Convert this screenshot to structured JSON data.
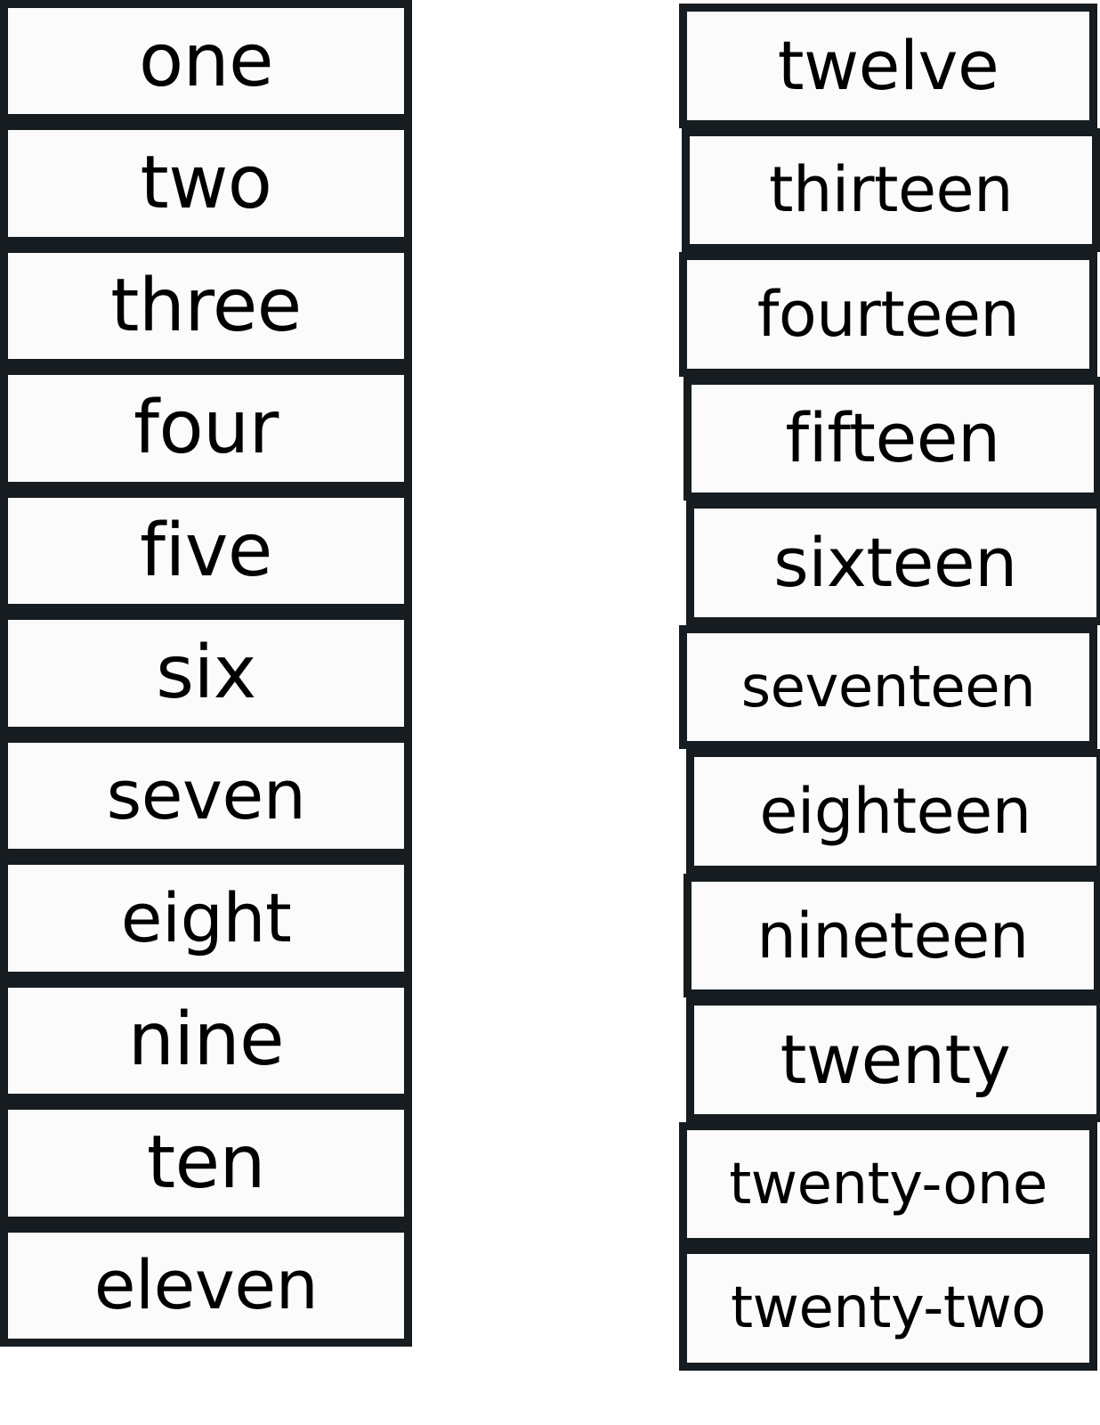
{
  "page": {
    "background_color": "#ffffff",
    "card_border_color": "#161c1f",
    "card_face_color": "#fbfbfb",
    "text_color": "#000000"
  },
  "columns": [
    {
      "id": "left",
      "name": "number-words-column-one-to-eleven",
      "cards": [
        {
          "word": "one"
        },
        {
          "word": "two"
        },
        {
          "word": "three"
        },
        {
          "word": "four"
        },
        {
          "word": "five"
        },
        {
          "word": "six"
        },
        {
          "word": "seven"
        },
        {
          "word": "eight"
        },
        {
          "word": "nine"
        },
        {
          "word": "ten"
        },
        {
          "word": "eleven"
        }
      ]
    },
    {
      "id": "right",
      "name": "number-words-column-twelve-to-twenty-two",
      "cards": [
        {
          "word": "twelve"
        },
        {
          "word": "thirteen"
        },
        {
          "word": "fourteen"
        },
        {
          "word": "fifteen"
        },
        {
          "word": "sixteen"
        },
        {
          "word": "seventeen"
        },
        {
          "word": "eighteen"
        },
        {
          "word": "nineteen"
        },
        {
          "word": "twenty"
        },
        {
          "word": "twenty-one"
        },
        {
          "word": "twenty-two"
        }
      ]
    }
  ]
}
